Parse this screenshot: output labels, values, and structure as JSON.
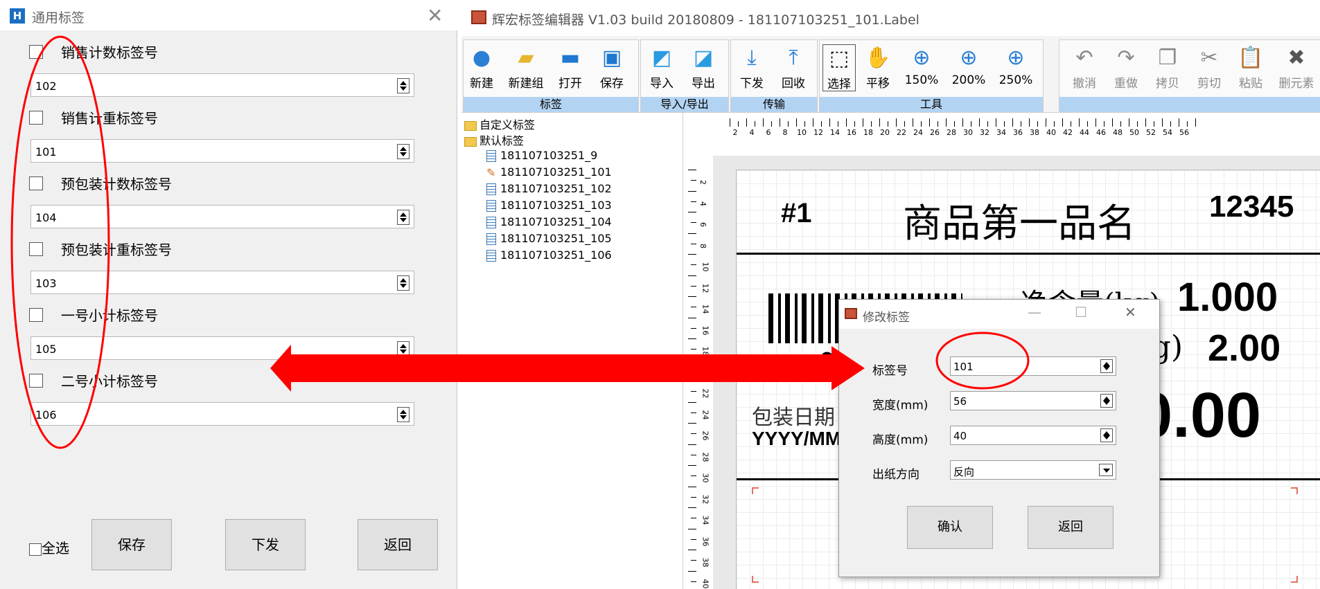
{
  "left_dialog": {
    "title": "通用标签",
    "fields": [
      {
        "label": "销售计数标签号",
        "value": "102"
      },
      {
        "label": "销售计重标签号",
        "value": "101"
      },
      {
        "label": "预包装计数标签号",
        "value": "104"
      },
      {
        "label": "预包装计重标签号",
        "value": "103"
      },
      {
        "label": "一号小计标签号",
        "value": "105"
      },
      {
        "label": "二号小计标签号",
        "value": "106"
      }
    ],
    "select_all": "全选",
    "save": "保存",
    "send": "下发",
    "back": "返回"
  },
  "editor": {
    "title": "辉宏标签编辑器 V1.03 build 20180809 - 181107103251_101.Label",
    "toolbar": {
      "groups": [
        {
          "label": "标签",
          "buttons": [
            "新建",
            "新建组",
            "打开",
            "保存"
          ]
        },
        {
          "label": "导入/导出",
          "buttons": [
            "导入",
            "导出"
          ]
        },
        {
          "label": "传输",
          "buttons": [
            "下发",
            "回收"
          ]
        },
        {
          "label": "工具",
          "buttons": [
            "选择",
            "平移",
            "150%",
            "200%",
            "250%"
          ]
        },
        {
          "label": "",
          "buttons": [
            "撤消",
            "重做",
            "拷贝",
            "剪切",
            "粘贴",
            "删元素"
          ]
        }
      ],
      "icons": [
        "new-icon",
        "new-group-icon",
        "open-folder-icon",
        "save-icon",
        "import-icon",
        "export-icon",
        "download-icon",
        "upload-icon",
        "select-cursor-icon",
        "pan-hand-icon",
        "zoom-150-icon",
        "zoom-200-icon",
        "zoom-250-icon",
        "undo-icon",
        "redo-icon",
        "copy-icon",
        "cut-icon",
        "paste-icon",
        "delete-icon"
      ]
    },
    "tree": {
      "custom": "自定义标签",
      "default": "默认标签",
      "items": [
        "181107103251_9",
        "181107103251_101",
        "181107103251_102",
        "181107103251_103",
        "181107103251_104",
        "181107103251_105",
        "181107103251_106"
      ]
    },
    "ruler": {
      "h_ticks": [
        "2",
        "4",
        "6",
        "8",
        "10",
        "12",
        "14",
        "16",
        "18",
        "20",
        "22",
        "24",
        "26",
        "28",
        "30",
        "32",
        "34",
        "36",
        "38",
        "40",
        "42",
        "44",
        "46",
        "48",
        "50",
        "52",
        "54",
        "56"
      ],
      "v_ticks": [
        "2",
        "4",
        "6",
        "8",
        "10",
        "12",
        "14",
        "16",
        "18",
        "20",
        "22",
        "24",
        "26",
        "28",
        "30",
        "32",
        "34",
        "36",
        "38",
        "40"
      ]
    },
    "label": {
      "num": "#1",
      "name": "商品第一品名",
      "code": "12345",
      "net_weight": "净含量(kg)",
      "weight_value": "1.000",
      "unit_price_label": "kg)",
      "unit_price": "2.00",
      "total": "0.00",
      "pack_date": "包装日期",
      "date_format": "YYYY/MM",
      "barcode_digit": "0"
    }
  },
  "modal": {
    "title": "修改标签",
    "label_no": {
      "label": "标签号",
      "value": "101"
    },
    "width": {
      "label": "宽度(mm)",
      "value": "56"
    },
    "height": {
      "label": "高度(mm)",
      "value": "40"
    },
    "direction": {
      "label": "出纸方向",
      "value": "反向"
    },
    "ok": "确认",
    "back": "返回"
  },
  "colors": {
    "annotation": "#ff0000",
    "ribbon_label": "#b3d3f2"
  }
}
